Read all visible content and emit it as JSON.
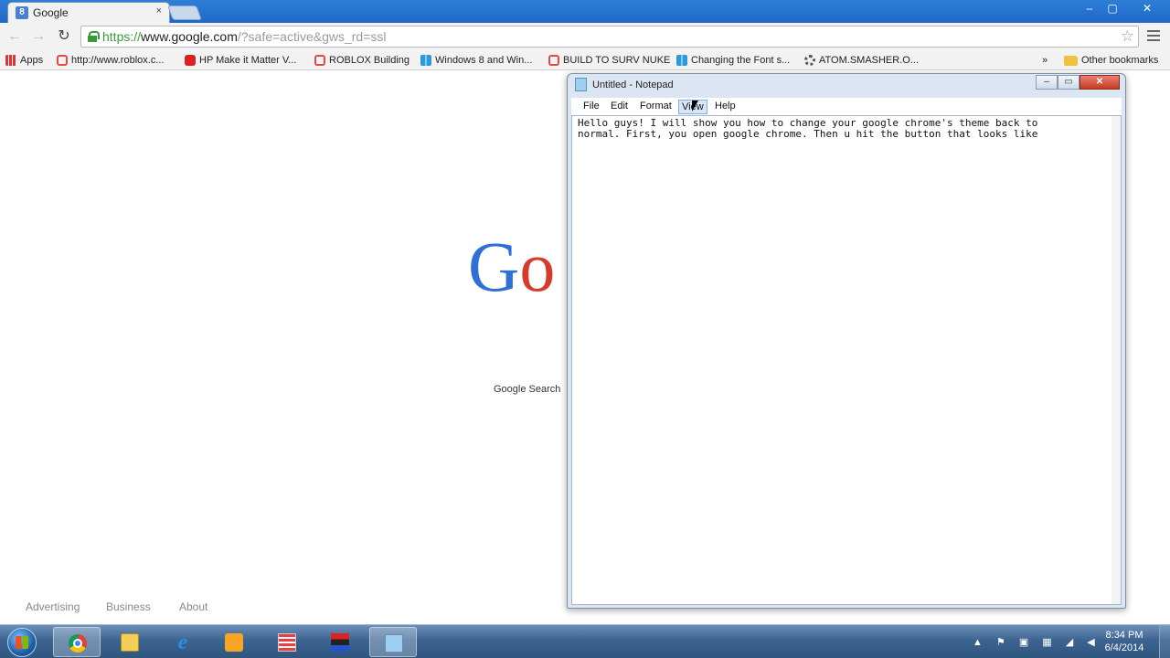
{
  "browser": {
    "tab_title": "Google",
    "tab_favicon": "8",
    "tab_close": "×",
    "url_scheme": "https://",
    "url_host": "www.google.com",
    "url_rest": "/?safe=active&gws_rd=ssl",
    "window_controls": [
      "–",
      "▢",
      "✕"
    ],
    "bookmarks": [
      {
        "label": "Apps",
        "icon": "apps-icon"
      },
      {
        "label": "http://www.roblox.c...",
        "icon": "roblox-icon"
      },
      {
        "label": "HP Make it Matter V...",
        "icon": "youtube-icon"
      },
      {
        "label": "ROBLOX Building",
        "icon": "roblox-icon"
      },
      {
        "label": "Windows 8 and Win...",
        "icon": "windows-icon"
      },
      {
        "label": "BUILD TO SURV NUKE",
        "icon": "roblox-icon"
      },
      {
        "label": "Changing the Font s...",
        "icon": "windows-icon"
      },
      {
        "label": "ATOM.SMASHER.O...",
        "icon": "gear-icon"
      }
    ],
    "bookmarks_overflow": "»",
    "other_bookmarks": "Other bookmarks"
  },
  "google": {
    "logo_g": "G",
    "logo_o": "o",
    "search_button": "Google Search",
    "footer": [
      "Advertising",
      "Business",
      "About"
    ]
  },
  "notepad": {
    "title": "Untitled - Notepad",
    "menus": [
      "File",
      "Edit",
      "Format",
      "View",
      "Help"
    ],
    "text_line1": "Hello guys! I will show you how to change your google chrome's theme back to",
    "text_line2": "normal. First, you open google chrome. Then u hit the button that looks like",
    "controls": [
      "–",
      "▭",
      "✕"
    ]
  },
  "taskbar": {
    "time": "8:34 PM",
    "date": "6/4/2014",
    "tray_icons": "▲ ⚑ ▣ ▦ ◢ ◀"
  },
  "colors": {
    "titlebar": "#1f69c6",
    "url_green": "#3b9a38",
    "google_blue": "#2f6fd6",
    "google_red": "#d63a2a"
  }
}
